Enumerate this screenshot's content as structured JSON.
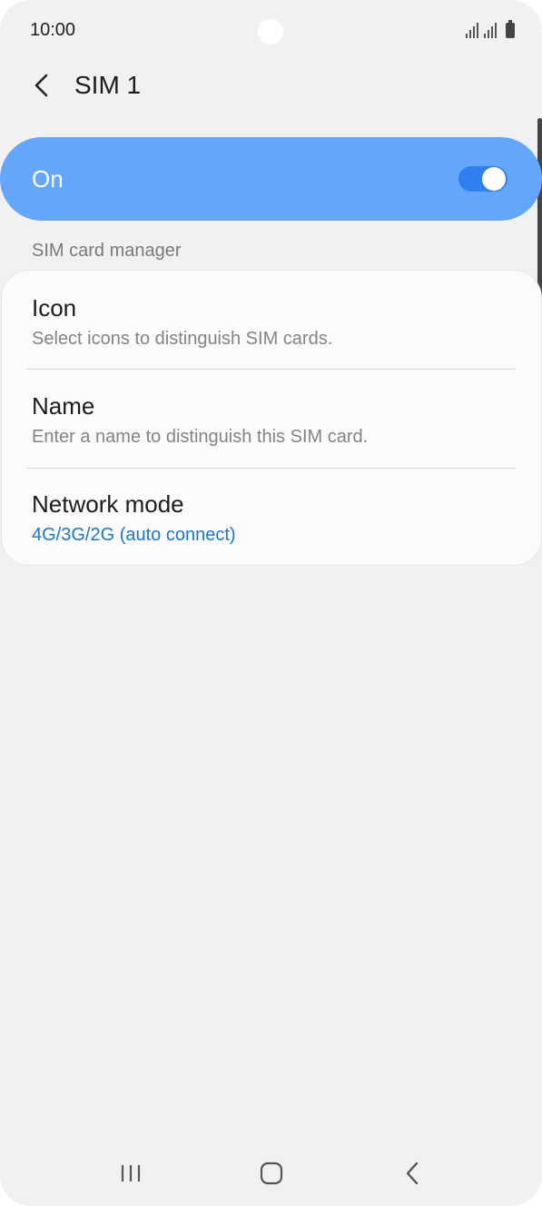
{
  "status_bar": {
    "time": "10:00"
  },
  "header": {
    "back_icon": "chevron-left-icon",
    "title": "SIM 1"
  },
  "master_switch": {
    "label": "On",
    "state": "on",
    "accent_color": "#64a6fb",
    "toggle_color": "#2f7ff2"
  },
  "section": {
    "title": "SIM card manager"
  },
  "settings": {
    "items": [
      {
        "title": "Icon",
        "subtitle": "Select icons to distinguish SIM cards."
      },
      {
        "title": "Name",
        "subtitle": "Enter a name to distinguish this SIM card."
      },
      {
        "title": "Network mode",
        "subtitle": "4G/3G/2G (auto connect)"
      }
    ],
    "accent_text_color": "#1d76cc"
  },
  "nav_bar": {
    "recents_icon": "recents-icon",
    "home_icon": "home-icon",
    "back_icon": "back-icon"
  }
}
